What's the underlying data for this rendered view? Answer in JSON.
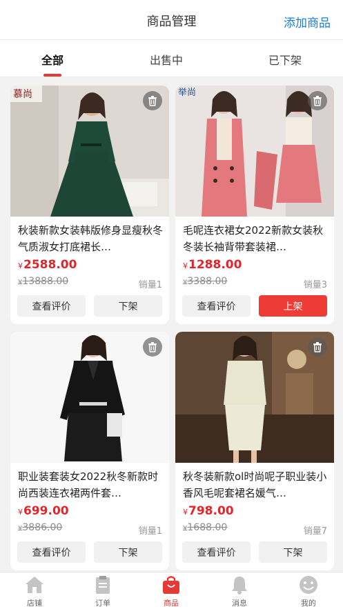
{
  "header": {
    "title": "商品管理",
    "action": "添加商品"
  },
  "tabs": [
    {
      "label": "全部",
      "active": true
    },
    {
      "label": "出售中",
      "active": false
    },
    {
      "label": "已下架",
      "active": false
    }
  ],
  "currency_symbol": "¥",
  "products": [
    {
      "name": "秋装新款女装韩版修身显瘦秋冬气质淑女打底裙长…",
      "price": "2588.00",
      "original_price": "13888.00",
      "sales": "销量1",
      "btn_review": "查看评价",
      "btn_action": "下架",
      "action_highlight": false
    },
    {
      "name": "毛呢连衣裙女2022新款女装秋冬装长袖背带套装裙…",
      "price": "1288.00",
      "original_price": "3388.00",
      "sales": "销量3",
      "btn_review": "查看评价",
      "btn_action": "上架",
      "action_highlight": true
    },
    {
      "name": "职业装套装女2022秋冬新款时尚西装连衣裙两件套…",
      "price": "699.00",
      "original_price": "3886.00",
      "sales": "销量1",
      "btn_review": "查看评价",
      "btn_action": "下架",
      "action_highlight": false
    },
    {
      "name": "秋冬装新款ol时尚呢子职业装小香风毛呢套裙名媛气…",
      "price": "798.00",
      "original_price": "1688.00",
      "sales": "销量7",
      "btn_review": "查看评价",
      "btn_action": "下架",
      "action_highlight": false
    }
  ],
  "tabbar": [
    {
      "label": "店铺",
      "icon": "store-icon",
      "active": false
    },
    {
      "label": "订单",
      "icon": "order-icon",
      "active": false
    },
    {
      "label": "商品",
      "icon": "goods-bag-icon",
      "active": true
    },
    {
      "label": "消息",
      "icon": "bell-icon",
      "active": false
    },
    {
      "label": "我的",
      "icon": "smile-icon",
      "active": false
    }
  ],
  "colors": {
    "accent": "#e53935",
    "link": "#1f7fd1",
    "button_red": "#ef3b36"
  }
}
